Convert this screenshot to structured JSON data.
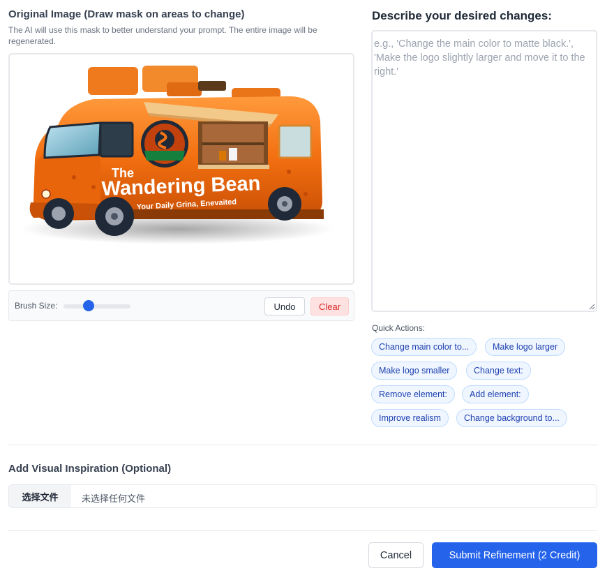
{
  "left": {
    "title": "Original Image (Draw mask on areas to change)",
    "description": "The AI will use this mask to better understand your prompt. The entire image will be regenerated.",
    "image": {
      "logo_text_top": "The",
      "logo_text_main": "Wandering Bean",
      "tagline": "Your Daily Grina, Enevaited"
    },
    "toolbar": {
      "brush_label": "Brush Size:",
      "brush_value": 0.38,
      "undo_label": "Undo",
      "clear_label": "Clear"
    }
  },
  "right": {
    "title": "Describe your desired changes:",
    "prompt_placeholder": "e.g., 'Change the main color to matte black.', 'Make the logo slightly larger and move it to the right.'",
    "quick_actions_label": "Quick Actions:",
    "quick_actions": [
      "Change main color to...",
      "Make logo larger",
      "Make logo smaller",
      "Change text:",
      "Remove element:",
      "Add element:",
      "Improve realism",
      "Change background to..."
    ]
  },
  "inspiration": {
    "title": "Add Visual Inspiration (Optional)",
    "choose_button": "选择文件",
    "file_status": "未选择任何文件"
  },
  "footer": {
    "cancel_label": "Cancel",
    "submit_label": "Submit Refinement (2 Credit)"
  },
  "colors": {
    "primary": "#2563eb",
    "chip_bg": "#eff6ff",
    "chip_text": "#1e40af",
    "clear_bg": "#fee2e2",
    "clear_text": "#dc2626",
    "truck_orange": "#f26f10"
  }
}
